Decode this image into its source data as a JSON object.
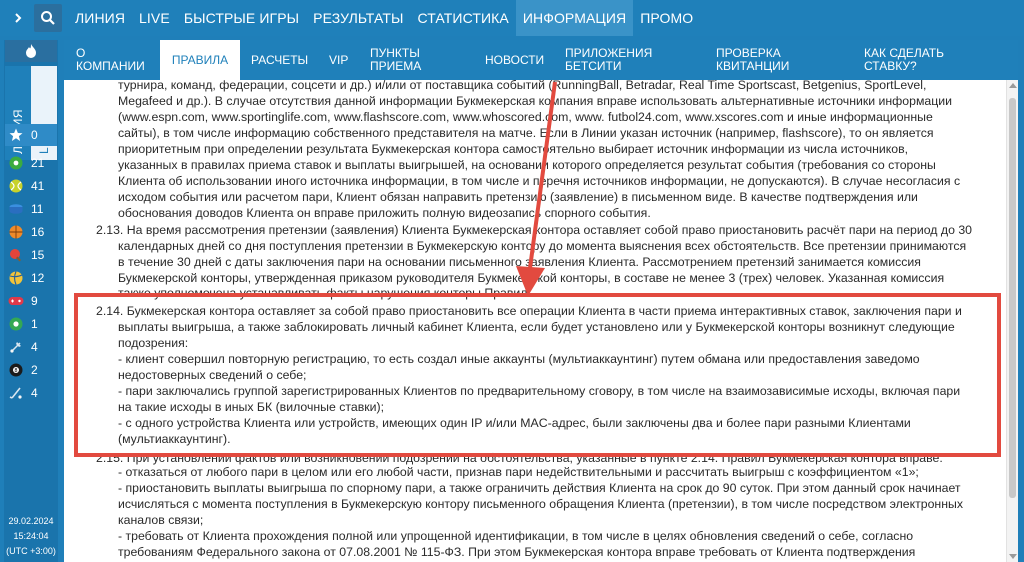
{
  "topnav": {
    "items": [
      "ЛИНИЯ",
      "LIVE",
      "БЫСТРЫЕ ИГРЫ",
      "РЕЗУЛЬТАТЫ",
      "СТАТИСТИКА",
      "ИНФОРМАЦИЯ",
      "ПРОМО"
    ],
    "active_index": 5
  },
  "sidebar": {
    "tab_line": "ЛИНИЯ",
    "tab_live": "LIVE",
    "favorites_count": "0",
    "sports": [
      {
        "icon": "soccer-ball-icon",
        "count": "21"
      },
      {
        "icon": "tennis-ball-icon",
        "count": "41"
      },
      {
        "icon": "hockey-puck-icon",
        "count": "11"
      },
      {
        "icon": "basketball-icon",
        "count": "16"
      },
      {
        "icon": "table-tennis-icon",
        "count": "15"
      },
      {
        "icon": "volleyball-icon",
        "count": "12"
      },
      {
        "icon": "gamepad-icon",
        "count": "9"
      },
      {
        "icon": "futsal-icon",
        "count": "1"
      },
      {
        "icon": "badminton-icon",
        "count": "4"
      },
      {
        "icon": "billiards-icon",
        "count": "2"
      },
      {
        "icon": "field-hockey-icon",
        "count": "4"
      }
    ],
    "date": "29.02.2024",
    "time": "15:24:04",
    "timezone": "(UTC +3:00)"
  },
  "tabs": {
    "about": "О КОМПАНИИ",
    "rules": "ПРАВИЛА",
    "payments": "РАСЧЕТЫ",
    "vip": "VIP",
    "points": "ПУНКТЫ ПРИЕМА",
    "news": "НОВОСТИ",
    "apps": "ПРИЛОЖЕНИЯ БЕТСИТИ",
    "check": "ПРОВЕРКА КВИТАНЦИИ",
    "howto": "КАК СДЕЛАТЬ СТАВКУ?"
  },
  "doc": {
    "l1": "турнира, команд, федерации, соцсети и др.) и/или от поставщика событий (RunningBall, Betradar, Real Time Sportscast, Betgenius, SportLevel,",
    "l2": "Megafeed и др.). В случае отсутствия данной информации Букмекерская компания вправе использовать альтернативные источники информации",
    "l3": "(www.espn.com, www.sportinglife.com, www.flashscore.com, www.whoscored.com, www. futbol24.com, www.xscores.com и иные информационные",
    "l4": "сайты), в том числе информацию собственного представителя на матче. Если в Линии указан источник (например, flashscore), то он является",
    "l5": "приоритетным при определении результата Букмекерская контора самостоятельно выбирает источник информации из числа источников,",
    "l6": "указанных в правилах приема ставок и выплаты выигрышей, на основании которого определяется результат события (требования со стороны",
    "l7": "Клиента об использовании иного источника информации, в том числе и перечня источников информации, не допускаются). В случае несогласия с",
    "l8": "исходом события или расчетом пари, Клиент обязан направить претензию (заявление) в письменном виде. В качестве подтверждения или",
    "l9": "обоснования доводов Клиента он вправе приложить полную видеозапись спорного события.",
    "p213a": "2.13. На время рассмотрения претензии (заявления) Клиента Букмекерская контора оставляет собой право приостановить расчёт пари на период до 30",
    "p213b": "календарных дней со дня поступления претензии в Букмекерскую контору до момента выяснения всех обстоятельств. Все претензии принимаются",
    "p213c": "в течение 30 дней с даты заключения пари на основании письменного заявления Клиента. Рассмотрением претензий занимается комиссия",
    "p213d": "Букмекерской конторы, утвержденная приказом руководителя Букмекерской конторы, в составе не менее 3 (трех) человек. Указанная комиссия",
    "p213e": "также уполномочена устанавливать факты нарушения конторы Правил.",
    "p214a": "2.14. Букмекерская контора оставляет за собой право приостановить все операции Клиента в части приема интерактивных ставок, заключения пари и",
    "p214b": "выплаты выигрыша, а также заблокировать личный кабинет Клиента, если будет установлено или у Букмекерской конторы возникнут следующие",
    "p214c": "подозрения:",
    "p214d": "- клиент совершил повторную регистрацию, то есть создал иные аккаунты (мультиаккаунтинг) путем обмана или предоставления заведомо",
    "p214e": "недостоверных сведений о себе;",
    "p214f": "- пари заключались группой зарегистрированных Клиентов по предварительному сговору, в том числе на взаимозависимые исходы, включая пари",
    "p214g": "на такие исходы в иных БК (вилочные ставки);",
    "p214h": "- с одного устройства Клиента или устройств, имеющих один IP и/или MAC-адрес, были заключены два и более пари разными Клиентами",
    "p214i": "(мультиаккаунтинг).",
    "p215a": "2.15. При установлении фактов или возникновении подозрений на обстоятельства, указанные в пункте 2.14. Правил Букмекерская контора вправе:",
    "p215b": "- отказаться от любого пари в целом или его любой части, признав пари недействительными и рассчитать выигрыш с коэффициентом «1»;",
    "p215c": "- приостановить выплаты выигрыша по спорному пари, а также ограничить действия Клиента на срок до 90 суток. При этом данный срок начинает",
    "p215d": "исчисляться с момента поступления в Букмекерскую контору письменного обращения Клиента (претензии), в том числе посредством электронных",
    "p215e": "каналов связи;",
    "p215f": "- требовать от Клиента прохождения полной или упрощенной идентификации, в том числе в целях обновления сведений о себе, согласно",
    "p215g": "требованиям Федерального закона от 07.08.2001 № 115-ФЗ. При этом Букмекерская контора вправе требовать от Клиента подтверждения"
  },
  "colors": {
    "brand_blue": "#1f80ba",
    "highlight_red": "#e24a3f"
  }
}
